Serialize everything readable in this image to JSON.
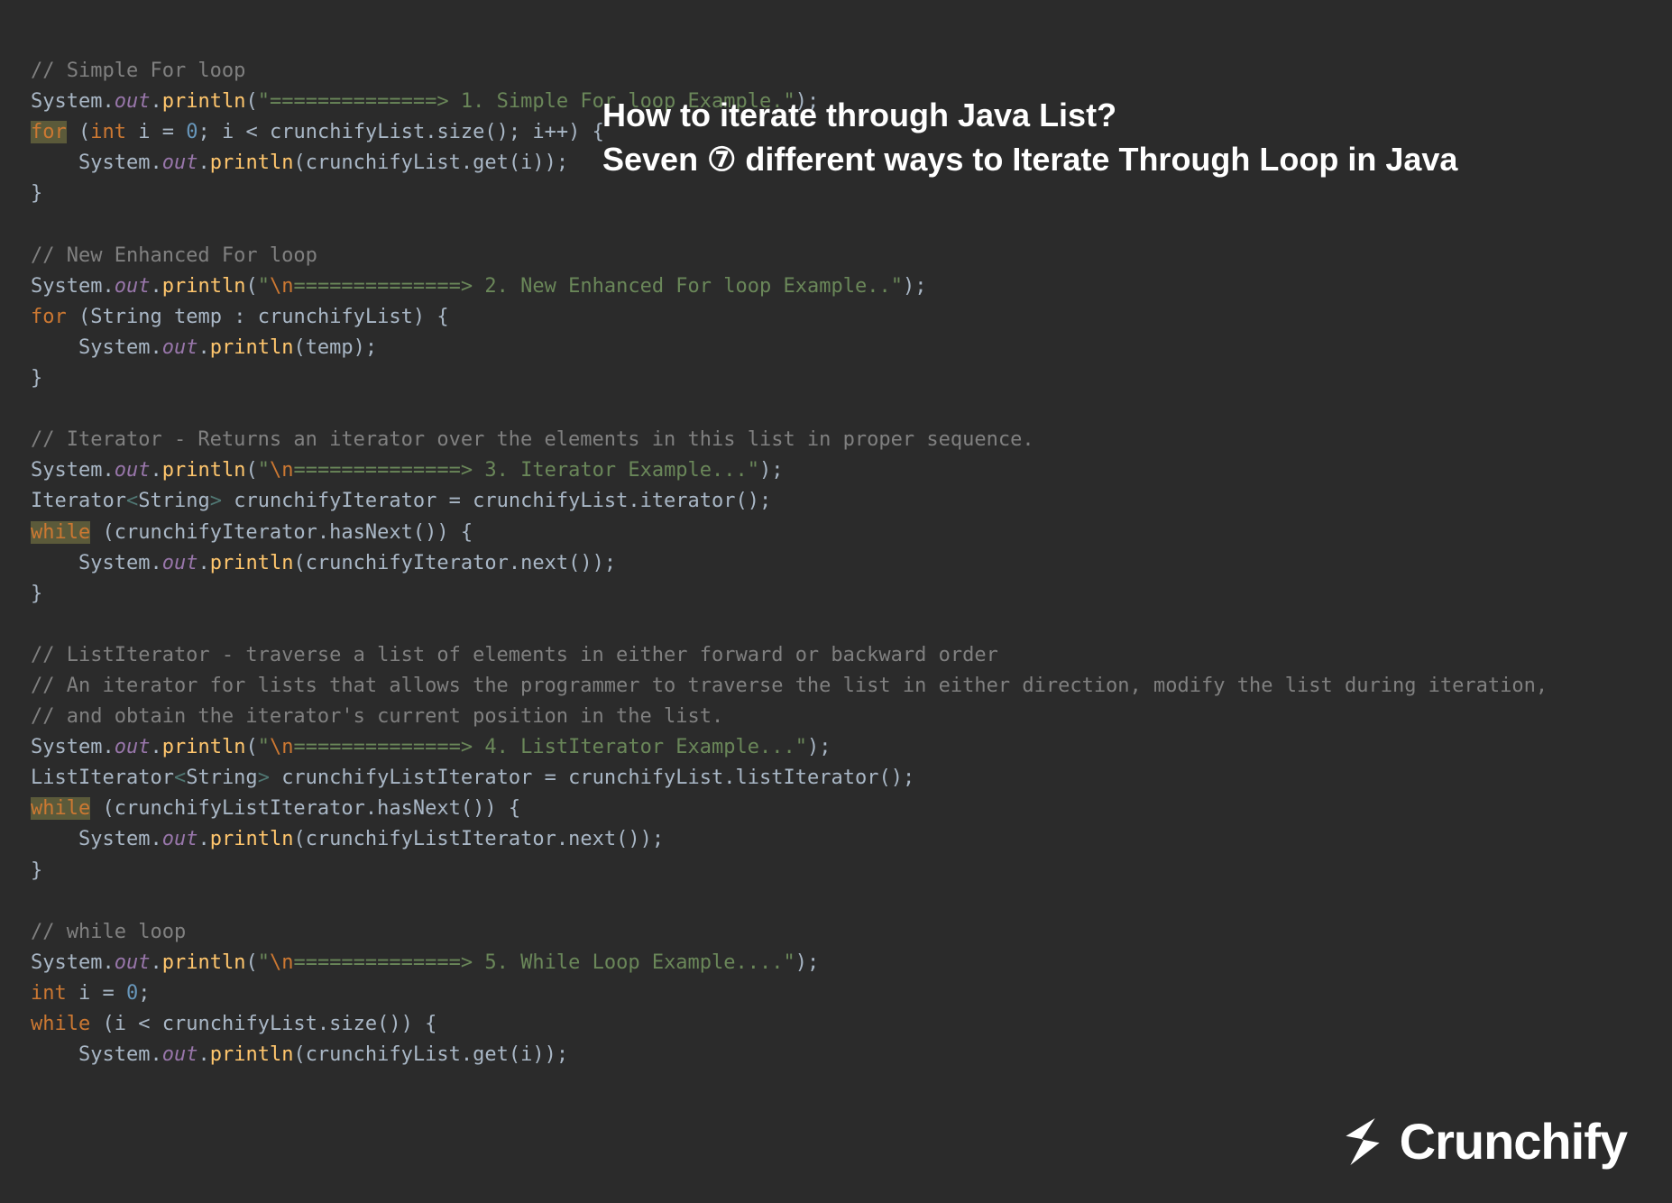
{
  "overlay": {
    "line1": "How to iterate through Java List?",
    "line2": "Seven ⑦ different ways to Iterate Through Loop in Java"
  },
  "logo": {
    "text": "Crunchify"
  },
  "code": {
    "c1": "// Simple For loop",
    "s1_arrow": "==============>",
    "s1_label": " 1. Simple For loop Example.",
    "c2": "// New Enhanced For loop",
    "s2_arrow": "==============>",
    "s2_label": " 2. New Enhanced For loop Example..",
    "c3": "// Iterator - Returns an iterator over the elements in this list in proper sequence.",
    "s3_arrow": "==============>",
    "s3_label": " 3. Iterator Example...",
    "c4a": "// ListIterator - traverse a list of elements in either forward or backward order",
    "c4b": "// An iterator for lists that allows the programmer to traverse the list in either direction, modify the list during iteration,",
    "c4c": "// and obtain the iterator's current position in the list.",
    "s4_arrow": "==============>",
    "s4_label": " 4. ListIterator Example...",
    "c5": "// while loop",
    "s5_arrow": "==============>",
    "s5_label": " 5. While Loop Example....",
    "kw_for": "for",
    "kw_int": "int",
    "kw_while": "while",
    "zero": "0",
    "sys": "System",
    "out": "out",
    "println": "println",
    "id_i": "i",
    "id_crunchifyList": "crunchifyList",
    "id_size": "size",
    "id_get": "get",
    "id_temp": "temp",
    "id_String": "String",
    "id_Iterator": "Iterator",
    "id_crunchifyIterator": "crunchifyIterator",
    "id_iterator": "iterator",
    "id_hasNext": "hasNext",
    "id_next": "next",
    "id_ListIterator": "ListIterator",
    "id_crunchifyListIterator": "crunchifyListIterator",
    "id_listIterator": "listIterator",
    "esc_n": "\\n"
  }
}
